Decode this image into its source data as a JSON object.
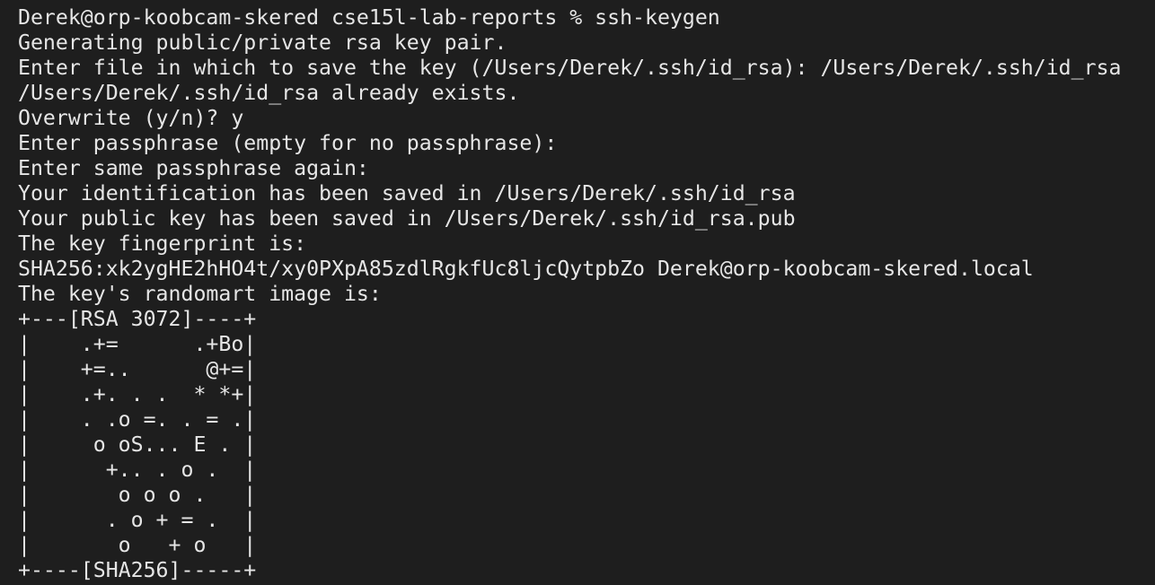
{
  "terminal": {
    "lines": [
      "Derek@orp-koobcam-skered cse15l-lab-reports % ssh-keygen",
      "Generating public/private rsa key pair.",
      "Enter file in which to save the key (/Users/Derek/.ssh/id_rsa): /Users/Derek/.ssh/id_rsa",
      "/Users/Derek/.ssh/id_rsa already exists.",
      "Overwrite (y/n)? y",
      "Enter passphrase (empty for no passphrase):",
      "Enter same passphrase again:",
      "Your identification has been saved in /Users/Derek/.ssh/id_rsa",
      "Your public key has been saved in /Users/Derek/.ssh/id_rsa.pub",
      "The key fingerprint is:",
      "SHA256:xk2ygHE2hHO4t/xy0PXpA85zdlRgkfUc8ljcQytpbZo Derek@orp-koobcam-skered.local",
      "The key's randomart image is:",
      "+---[RSA 3072]----+",
      "|    .+=      .+Bo|",
      "|    +=..      @+=|",
      "|    .+. . .  * *+|",
      "|    . .o =. . = .|",
      "|     o oS... E . |",
      "|      +.. . o .  |",
      "|       o o o .   |",
      "|      . o + = .  |",
      "|       o   + o   |",
      "+----[SHA256]-----+"
    ]
  }
}
